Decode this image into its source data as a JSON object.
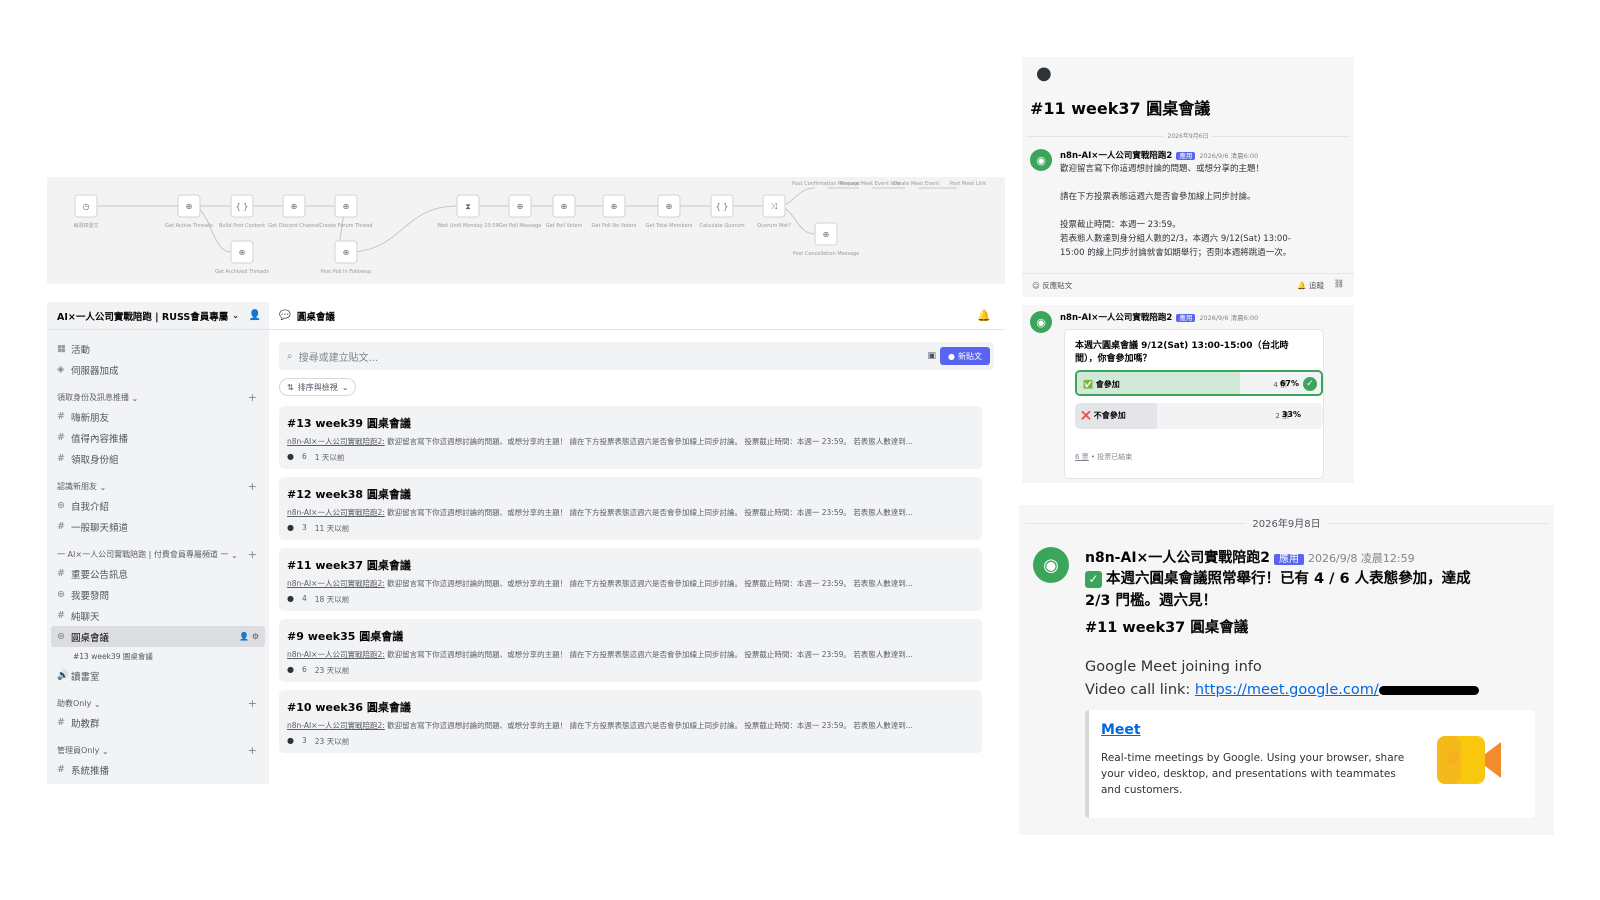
{
  "colors": {
    "discord_blurple": "#5865f2",
    "success_green": "#3ba55c",
    "link_blue": "#0068e0",
    "sidebar_bg": "#f2f3f5"
  },
  "workflow": {
    "nodes": [
      {
        "label": "每週四發文",
        "icon": "clock-icon"
      },
      {
        "label": "Get Active Threads",
        "icon": "globe-icon"
      },
      {
        "label": "Build Post Content",
        "icon": "code-icon"
      },
      {
        "label": "Get Discord Channel",
        "icon": "globe-icon"
      },
      {
        "label": "Create Forum Thread",
        "icon": "globe-icon"
      },
      {
        "label": "Get Archived Threads",
        "icon": "globe-icon"
      },
      {
        "label": "Post Poll In Followup",
        "icon": "globe-icon"
      },
      {
        "label": "Wait Until Monday 23:59",
        "icon": "hourglass-icon"
      },
      {
        "label": "Get Poll Message",
        "icon": "globe-icon"
      },
      {
        "label": "Get Poll Voters",
        "icon": "globe-icon"
      },
      {
        "label": "Get Poll No Voters",
        "icon": "globe-icon"
      },
      {
        "label": "Get Total Members",
        "icon": "globe-icon"
      },
      {
        "label": "Calculate Quorum",
        "icon": "code-icon"
      },
      {
        "label": "Quorum Met?",
        "icon": "branch-icon"
      },
      {
        "label": "Post Cancellation Message",
        "icon": "globe-icon"
      },
      {
        "label": "Post Confirmation Message",
        "icon": "none"
      },
      {
        "label": "Prepare Meet Event Info",
        "icon": "none"
      },
      {
        "label": "Create Meet Event",
        "icon": "none"
      },
      {
        "label": "Post Meet Link",
        "icon": "none"
      }
    ]
  },
  "sidebar": {
    "server_name": "AI×一人公司實戰陪跑 | RUSS會員專屬",
    "top_items": [
      {
        "icon": "calendar-icon",
        "label": "活動"
      },
      {
        "icon": "boost-icon",
        "label": "伺服器加成"
      }
    ],
    "categories": [
      {
        "label": "領取身份及訊息推播",
        "items": [
          {
            "icon": "#",
            "label": "嗨新朋友"
          },
          {
            "icon": "#",
            "label": "值得內容推播"
          },
          {
            "icon": "#",
            "label": "領取身份組"
          }
        ]
      },
      {
        "label": "認識新朋友",
        "items": [
          {
            "icon": "forum",
            "label": "自我介紹"
          },
          {
            "icon": "#",
            "label": "一般聊天頻道"
          }
        ]
      },
      {
        "label": "一 AI×一人公司實戰陪跑 | 付費會員專屬頻道 一",
        "items": [
          {
            "icon": "#",
            "label": "重要公告訊息"
          },
          {
            "icon": "forum",
            "label": "我要發問"
          },
          {
            "icon": "#",
            "label": "純聊天"
          },
          {
            "icon": "forum",
            "label": "圓桌會議",
            "active": true
          },
          {
            "icon": "sub",
            "label": "#13 week39 圓桌會議"
          },
          {
            "icon": "voice",
            "label": "讀書室"
          }
        ]
      },
      {
        "label": "助教Only",
        "items": [
          {
            "icon": "#",
            "label": "助教群"
          }
        ]
      },
      {
        "label": "管理員Only",
        "items": [
          {
            "icon": "#",
            "label": "系統推播"
          }
        ]
      }
    ]
  },
  "forum": {
    "channel_name": "圓桌會議",
    "search_placeholder": "搜尋或建立貼文...",
    "new_post_label": "新貼文",
    "sort_label": "排序與檢視",
    "posts": [
      {
        "title": "#13 week39 圓桌會議",
        "author": "n8n-AI×一人公司實戰陪跑2:",
        "preview": " 歡迎留言寫下你這週想討論的問題、或想分享的主題！ 請在下方投票表態這週六是否會參加線上同步討論。 投票截止時間：本週一 23:59。 若表態人數達到...",
        "replies": "6",
        "age": "1 天以前"
      },
      {
        "title": "#12 week38 圓桌會議",
        "author": "n8n-AI×一人公司實戰陪跑2:",
        "preview": " 歡迎留言寫下你這週想討論的問題、或想分享的主題！ 請在下方投票表態這週六是否會參加線上同步討論。 投票截止時間：本週一 23:59。 若表態人數達到...",
        "replies": "3",
        "age": "11 天以前"
      },
      {
        "title": "#11 week37 圓桌會議",
        "author": "n8n-AI×一人公司實戰陪跑2:",
        "preview": " 歡迎留言寫下你這週想討論的問題、或想分享的主題！ 請在下方投票表態這週六是否會參加線上同步討論。 投票截止時間：本週一 23:59。 若表態人數達到...",
        "replies": "4",
        "age": "18 天以前"
      },
      {
        "title": "#9 week35 圓桌會議",
        "author": "n8n-AI×一人公司實戰陪跑2:",
        "preview": " 歡迎留言寫下你這週想討論的問題、或想分享的主題！ 請在下方投票表態這週六是否會參加線上同步討論。 投票截止時間：本週一 23:59。 若表態人數達到...",
        "replies": "6",
        "age": "23 天以前"
      },
      {
        "title": "#10 week36 圓桌會議",
        "author": "n8n-AI×一人公司實戰陪跑2:",
        "preview": " 歡迎留言寫下你這週想討論的問題、或想分享的主題！ 請在下方投票表態這週六是否會參加線上同步討論。 投票截止時間：本週一 23:59。 若表態人數達到...",
        "replies": "3",
        "age": "23 天以前"
      }
    ]
  },
  "thread": {
    "title": "#11 week37 圓桌會議",
    "date_divider": "2026年9月6日",
    "bot_name": "n8n-AI×一人公司實戰陪跑2",
    "app_tag": "應用",
    "timestamp": "2026/9/6 清晨6:00",
    "lines": [
      "歡迎留言寫下你這週想討論的問題、或想分享的主題！",
      "請在下方投票表態這週六是否會參加線上同步討論。",
      "投票截止時間：本週一 23:59。",
      "若表態人數達到身分組人數的2/3，本週六 9/12(Sat) 13:00-",
      "15:00 的線上同步討論就會如期舉行；否則本週將跳過一次。"
    ],
    "react_label": "反應貼文",
    "follow_label": "追蹤"
  },
  "poll": {
    "bot_name": "n8n-AI×一人公司實戰陪跑2",
    "app_tag": "應用",
    "timestamp": "2026/9/6 清晨6:00",
    "question_line1": "本週六圓桌會議 9/12(Sat) 13:00-15:00（台北時",
    "question_line2": "間），你會參加嗎？",
    "options": [
      {
        "emoji": "✅",
        "label": "會參加",
        "votes": "4 票",
        "percent": "67%",
        "fraction": 0.67,
        "selected": true
      },
      {
        "emoji": "❌",
        "label": "不會參加",
        "votes": "2 票",
        "percent": "33%",
        "fraction": 0.33,
        "selected": false
      }
    ],
    "total_votes": "6 票",
    "status": "投票已結束"
  },
  "announcement": {
    "date_divider": "2026年9月8日",
    "bot_name": "n8n-AI×一人公司實戰陪跑2",
    "app_tag": "應用",
    "timestamp": "2026/9/8 凌晨12:59",
    "line1": "本週六圓桌會議照常舉行！已有 4 / 6 人表態參加，達成",
    "line2": "2/3 門檻。週六見！",
    "line3": "#11 week37 圓桌會議",
    "meet_info": "Google Meet joining info",
    "video_label": "Video call link: ",
    "video_link": "https://meet.google.com/",
    "embed": {
      "title": "Meet",
      "desc1": "Real-time meetings by Google. Using your browser, share",
      "desc2": "your video, desktop, and presentations with teammates",
      "desc3": "and customers."
    }
  }
}
